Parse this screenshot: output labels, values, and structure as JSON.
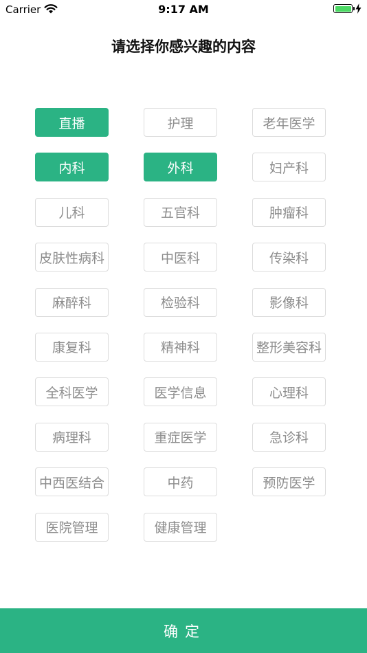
{
  "status_bar": {
    "carrier": "Carrier",
    "time": "9:17 AM",
    "battery_level": 1.0,
    "battery_color": "#4cd964"
  },
  "title": "请选择你感兴趣的内容",
  "accent_color": "#2bb384",
  "tags": [
    {
      "label": "直播",
      "selected": true
    },
    {
      "label": "护理",
      "selected": false
    },
    {
      "label": "老年医学",
      "selected": false
    },
    {
      "label": "内科",
      "selected": true
    },
    {
      "label": "外科",
      "selected": true
    },
    {
      "label": "妇产科",
      "selected": false
    },
    {
      "label": "儿科",
      "selected": false
    },
    {
      "label": "五官科",
      "selected": false
    },
    {
      "label": "肿瘤科",
      "selected": false
    },
    {
      "label": "皮肤性病科",
      "selected": false
    },
    {
      "label": "中医科",
      "selected": false
    },
    {
      "label": "传染科",
      "selected": false
    },
    {
      "label": "麻醉科",
      "selected": false
    },
    {
      "label": "检验科",
      "selected": false
    },
    {
      "label": "影像科",
      "selected": false
    },
    {
      "label": "康复科",
      "selected": false
    },
    {
      "label": "精神科",
      "selected": false
    },
    {
      "label": "整形美容科",
      "selected": false
    },
    {
      "label": "全科医学",
      "selected": false
    },
    {
      "label": "医学信息",
      "selected": false
    },
    {
      "label": "心理科",
      "selected": false
    },
    {
      "label": "病理科",
      "selected": false
    },
    {
      "label": "重症医学",
      "selected": false
    },
    {
      "label": "急诊科",
      "selected": false
    },
    {
      "label": "中西医结合",
      "selected": false
    },
    {
      "label": "中药",
      "selected": false
    },
    {
      "label": "预防医学",
      "selected": false
    },
    {
      "label": "医院管理",
      "selected": false
    },
    {
      "label": "健康管理",
      "selected": false
    }
  ],
  "confirm_label": "确定"
}
